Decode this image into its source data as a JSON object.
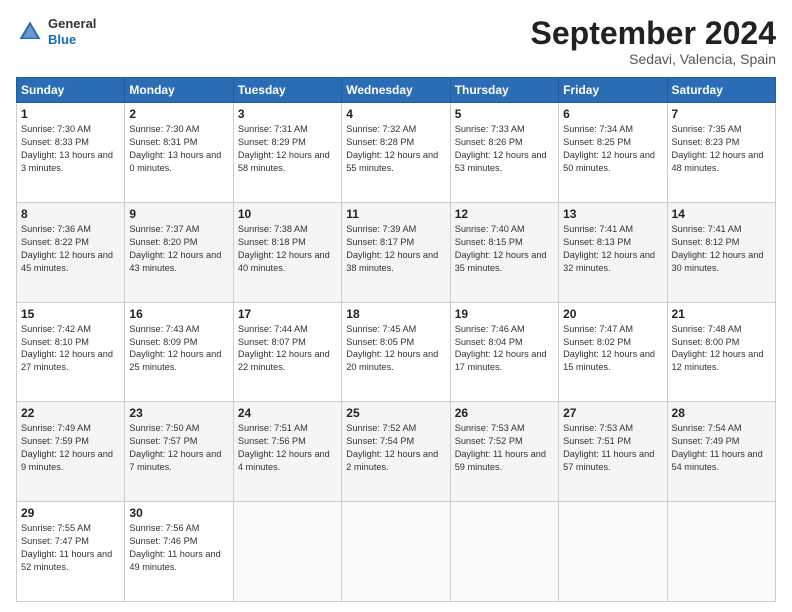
{
  "header": {
    "logo_general": "General",
    "logo_blue": "Blue",
    "month_title": "September 2024",
    "location": "Sedavi, Valencia, Spain"
  },
  "calendar": {
    "headers": [
      "Sunday",
      "Monday",
      "Tuesday",
      "Wednesday",
      "Thursday",
      "Friday",
      "Saturday"
    ],
    "weeks": [
      [
        {
          "day": "1",
          "sunrise": "Sunrise: 7:30 AM",
          "sunset": "Sunset: 8:33 PM",
          "daylight": "Daylight: 13 hours and 3 minutes."
        },
        {
          "day": "2",
          "sunrise": "Sunrise: 7:30 AM",
          "sunset": "Sunset: 8:31 PM",
          "daylight": "Daylight: 13 hours and 0 minutes."
        },
        {
          "day": "3",
          "sunrise": "Sunrise: 7:31 AM",
          "sunset": "Sunset: 8:29 PM",
          "daylight": "Daylight: 12 hours and 58 minutes."
        },
        {
          "day": "4",
          "sunrise": "Sunrise: 7:32 AM",
          "sunset": "Sunset: 8:28 PM",
          "daylight": "Daylight: 12 hours and 55 minutes."
        },
        {
          "day": "5",
          "sunrise": "Sunrise: 7:33 AM",
          "sunset": "Sunset: 8:26 PM",
          "daylight": "Daylight: 12 hours and 53 minutes."
        },
        {
          "day": "6",
          "sunrise": "Sunrise: 7:34 AM",
          "sunset": "Sunset: 8:25 PM",
          "daylight": "Daylight: 12 hours and 50 minutes."
        },
        {
          "day": "7",
          "sunrise": "Sunrise: 7:35 AM",
          "sunset": "Sunset: 8:23 PM",
          "daylight": "Daylight: 12 hours and 48 minutes."
        }
      ],
      [
        {
          "day": "8",
          "sunrise": "Sunrise: 7:36 AM",
          "sunset": "Sunset: 8:22 PM",
          "daylight": "Daylight: 12 hours and 45 minutes."
        },
        {
          "day": "9",
          "sunrise": "Sunrise: 7:37 AM",
          "sunset": "Sunset: 8:20 PM",
          "daylight": "Daylight: 12 hours and 43 minutes."
        },
        {
          "day": "10",
          "sunrise": "Sunrise: 7:38 AM",
          "sunset": "Sunset: 8:18 PM",
          "daylight": "Daylight: 12 hours and 40 minutes."
        },
        {
          "day": "11",
          "sunrise": "Sunrise: 7:39 AM",
          "sunset": "Sunset: 8:17 PM",
          "daylight": "Daylight: 12 hours and 38 minutes."
        },
        {
          "day": "12",
          "sunrise": "Sunrise: 7:40 AM",
          "sunset": "Sunset: 8:15 PM",
          "daylight": "Daylight: 12 hours and 35 minutes."
        },
        {
          "day": "13",
          "sunrise": "Sunrise: 7:41 AM",
          "sunset": "Sunset: 8:13 PM",
          "daylight": "Daylight: 12 hours and 32 minutes."
        },
        {
          "day": "14",
          "sunrise": "Sunrise: 7:41 AM",
          "sunset": "Sunset: 8:12 PM",
          "daylight": "Daylight: 12 hours and 30 minutes."
        }
      ],
      [
        {
          "day": "15",
          "sunrise": "Sunrise: 7:42 AM",
          "sunset": "Sunset: 8:10 PM",
          "daylight": "Daylight: 12 hours and 27 minutes."
        },
        {
          "day": "16",
          "sunrise": "Sunrise: 7:43 AM",
          "sunset": "Sunset: 8:09 PM",
          "daylight": "Daylight: 12 hours and 25 minutes."
        },
        {
          "day": "17",
          "sunrise": "Sunrise: 7:44 AM",
          "sunset": "Sunset: 8:07 PM",
          "daylight": "Daylight: 12 hours and 22 minutes."
        },
        {
          "day": "18",
          "sunrise": "Sunrise: 7:45 AM",
          "sunset": "Sunset: 8:05 PM",
          "daylight": "Daylight: 12 hours and 20 minutes."
        },
        {
          "day": "19",
          "sunrise": "Sunrise: 7:46 AM",
          "sunset": "Sunset: 8:04 PM",
          "daylight": "Daylight: 12 hours and 17 minutes."
        },
        {
          "day": "20",
          "sunrise": "Sunrise: 7:47 AM",
          "sunset": "Sunset: 8:02 PM",
          "daylight": "Daylight: 12 hours and 15 minutes."
        },
        {
          "day": "21",
          "sunrise": "Sunrise: 7:48 AM",
          "sunset": "Sunset: 8:00 PM",
          "daylight": "Daylight: 12 hours and 12 minutes."
        }
      ],
      [
        {
          "day": "22",
          "sunrise": "Sunrise: 7:49 AM",
          "sunset": "Sunset: 7:59 PM",
          "daylight": "Daylight: 12 hours and 9 minutes."
        },
        {
          "day": "23",
          "sunrise": "Sunrise: 7:50 AM",
          "sunset": "Sunset: 7:57 PM",
          "daylight": "Daylight: 12 hours and 7 minutes."
        },
        {
          "day": "24",
          "sunrise": "Sunrise: 7:51 AM",
          "sunset": "Sunset: 7:56 PM",
          "daylight": "Daylight: 12 hours and 4 minutes."
        },
        {
          "day": "25",
          "sunrise": "Sunrise: 7:52 AM",
          "sunset": "Sunset: 7:54 PM",
          "daylight": "Daylight: 12 hours and 2 minutes."
        },
        {
          "day": "26",
          "sunrise": "Sunrise: 7:53 AM",
          "sunset": "Sunset: 7:52 PM",
          "daylight": "Daylight: 11 hours and 59 minutes."
        },
        {
          "day": "27",
          "sunrise": "Sunrise: 7:53 AM",
          "sunset": "Sunset: 7:51 PM",
          "daylight": "Daylight: 11 hours and 57 minutes."
        },
        {
          "day": "28",
          "sunrise": "Sunrise: 7:54 AM",
          "sunset": "Sunset: 7:49 PM",
          "daylight": "Daylight: 11 hours and 54 minutes."
        }
      ],
      [
        {
          "day": "29",
          "sunrise": "Sunrise: 7:55 AM",
          "sunset": "Sunset: 7:47 PM",
          "daylight": "Daylight: 11 hours and 52 minutes."
        },
        {
          "day": "30",
          "sunrise": "Sunrise: 7:56 AM",
          "sunset": "Sunset: 7:46 PM",
          "daylight": "Daylight: 11 hours and 49 minutes."
        },
        {
          "day": "",
          "sunrise": "",
          "sunset": "",
          "daylight": ""
        },
        {
          "day": "",
          "sunrise": "",
          "sunset": "",
          "daylight": ""
        },
        {
          "day": "",
          "sunrise": "",
          "sunset": "",
          "daylight": ""
        },
        {
          "day": "",
          "sunrise": "",
          "sunset": "",
          "daylight": ""
        },
        {
          "day": "",
          "sunrise": "",
          "sunset": "",
          "daylight": ""
        }
      ]
    ]
  }
}
